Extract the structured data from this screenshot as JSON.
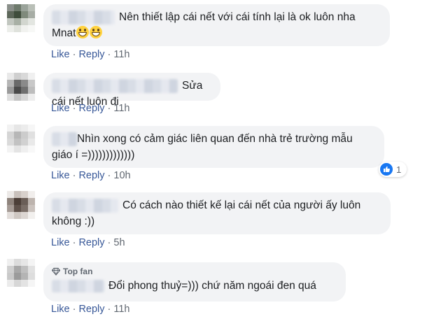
{
  "comments": [
    {
      "text_line1": "Nên thiết lập cái nết với cái tính lại là ok luôn nha",
      "text_line2": "Mnat",
      "emoji_name": "grinning-face-with-smiling-eyes-icon",
      "like": "Like",
      "separator": "·",
      "reply": "Reply",
      "time": "11h"
    },
    {
      "text": "Sửa cái nết luôn đi",
      "like": "Like",
      "separator": "·",
      "reply": "Reply",
      "time": "11h"
    },
    {
      "text_line1": "Nhìn xong có cảm giác liên quan đến nhà trẻ trường mẫu",
      "text_line2": "giáo í =)))))))))))))",
      "reaction_count": "1",
      "reaction_icon": "like-thumb-icon",
      "like": "Like",
      "separator": "·",
      "reply": "Reply",
      "time": "10h"
    },
    {
      "text_line1": "Có cách nào thiết kế lại cái nết của người ấy luôn",
      "text_line2": "không :))",
      "like": "Like",
      "separator": "·",
      "reply": "Reply",
      "time": "5h"
    },
    {
      "badge": "Top fan",
      "badge_icon": "diamond-icon",
      "text": "Đổi phong thuỷ=))) chứ năm ngoái đen quá",
      "like": "Like",
      "separator": "·",
      "reply": "Reply",
      "time": "11h"
    }
  ],
  "colors": {
    "bubble": "#f2f3f5",
    "link": "#385898",
    "meta": "#606770",
    "like_blue": "#1877f2"
  }
}
